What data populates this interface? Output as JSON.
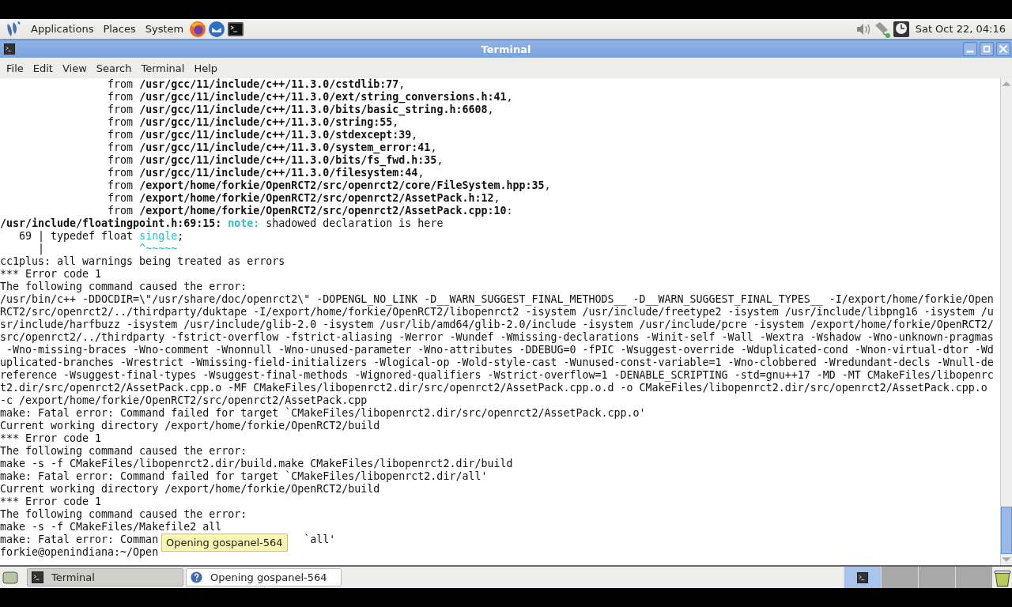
{
  "top_panel": {
    "menus": [
      "Applications",
      "Places",
      "System"
    ],
    "clock": "Sat Oct 22, 04:16"
  },
  "window": {
    "title": "Terminal"
  },
  "menubar": [
    "File",
    "Edit",
    "View",
    "Search",
    "Terminal",
    "Help"
  ],
  "terminal": {
    "lines": [
      [
        {
          "text": "                 from ",
          "kind": "plain"
        },
        {
          "text": "/usr/gcc/11/include/c++/11.3.0/cstdlib:77",
          "kind": "bold"
        },
        {
          "text": ",",
          "kind": "plain"
        }
      ],
      [
        {
          "text": "                 from ",
          "kind": "plain"
        },
        {
          "text": "/usr/gcc/11/include/c++/11.3.0/ext/string_conversions.h:41",
          "kind": "bold"
        },
        {
          "text": ",",
          "kind": "plain"
        }
      ],
      [
        {
          "text": "                 from ",
          "kind": "plain"
        },
        {
          "text": "/usr/gcc/11/include/c++/11.3.0/bits/basic_string.h:6608",
          "kind": "bold"
        },
        {
          "text": ",",
          "kind": "plain"
        }
      ],
      [
        {
          "text": "                 from ",
          "kind": "plain"
        },
        {
          "text": "/usr/gcc/11/include/c++/11.3.0/string:55",
          "kind": "bold"
        },
        {
          "text": ",",
          "kind": "plain"
        }
      ],
      [
        {
          "text": "                 from ",
          "kind": "plain"
        },
        {
          "text": "/usr/gcc/11/include/c++/11.3.0/stdexcept:39",
          "kind": "bold"
        },
        {
          "text": ",",
          "kind": "plain"
        }
      ],
      [
        {
          "text": "                 from ",
          "kind": "plain"
        },
        {
          "text": "/usr/gcc/11/include/c++/11.3.0/system_error:41",
          "kind": "bold"
        },
        {
          "text": ",",
          "kind": "plain"
        }
      ],
      [
        {
          "text": "                 from ",
          "kind": "plain"
        },
        {
          "text": "/usr/gcc/11/include/c++/11.3.0/bits/fs_fwd.h:35",
          "kind": "bold"
        },
        {
          "text": ",",
          "kind": "plain"
        }
      ],
      [
        {
          "text": "                 from ",
          "kind": "plain"
        },
        {
          "text": "/usr/gcc/11/include/c++/11.3.0/filesystem:44",
          "kind": "bold"
        },
        {
          "text": ",",
          "kind": "plain"
        }
      ],
      [
        {
          "text": "                 from ",
          "kind": "plain"
        },
        {
          "text": "/export/home/forkie/OpenRCT2/src/openrct2/core/FileSystem.hpp:35",
          "kind": "bold"
        },
        {
          "text": ",",
          "kind": "plain"
        }
      ],
      [
        {
          "text": "                 from ",
          "kind": "plain"
        },
        {
          "text": "/export/home/forkie/OpenRCT2/src/openrct2/AssetPack.h:12",
          "kind": "bold"
        },
        {
          "text": ",",
          "kind": "plain"
        }
      ],
      [
        {
          "text": "                 from ",
          "kind": "plain"
        },
        {
          "text": "/export/home/forkie/OpenRCT2/src/openrct2/AssetPack.cpp:10",
          "kind": "bold"
        },
        {
          "text": ":",
          "kind": "plain"
        }
      ],
      [
        {
          "text": "/usr/include/floatingpoint.h:69:15: ",
          "kind": "bold"
        },
        {
          "text": "note:",
          "kind": "note"
        },
        {
          "text": " shadowed declaration is here",
          "kind": "plain"
        }
      ],
      [
        {
          "text": "   69 | typedef float ",
          "kind": "plain"
        },
        {
          "text": "single",
          "kind": "cyan"
        },
        {
          "text": ";",
          "kind": "plain"
        }
      ],
      [
        {
          "text": "      |               ",
          "kind": "plain"
        },
        {
          "text": "^~~~~~",
          "kind": "cyan"
        }
      ],
      [
        {
          "text": "cc1plus: all warnings being treated as errors",
          "kind": "plain"
        }
      ],
      [
        {
          "text": "*** Error code 1",
          "kind": "plain"
        }
      ],
      [
        {
          "text": "The following command caused the error:",
          "kind": "plain"
        }
      ],
      [
        {
          "text": "/usr/bin/c++ -DDOCDIR=\\\"/usr/share/doc/openrct2\\\" -DOPENGL_NO_LINK -D__WARN_SUGGEST_FINAL_METHODS__ -D__WARN_SUGGEST_FINAL_TYPES__ -I/export/home/forkie/Open",
          "kind": "plain"
        }
      ],
      [
        {
          "text": "RCT2/src/openrct2/../thirdparty/duktape -I/export/home/forkie/OpenRCT2/libopenrct2 -isystem /usr/include/freetype2 -isystem /usr/include/libpng16 -isystem /u",
          "kind": "plain"
        }
      ],
      [
        {
          "text": "sr/include/harfbuzz -isystem /usr/include/glib-2.0 -isystem /usr/lib/amd64/glib-2.0/include -isystem /usr/include/pcre -isystem /export/home/forkie/OpenRCT2/",
          "kind": "plain"
        }
      ],
      [
        {
          "text": "src/openrct2/../thirdparty -fstrict-overflow -fstrict-aliasing -Werror -Wundef -Wmissing-declarations -Winit-self -Wall -Wextra -Wshadow -Wno-unknown-pragmas",
          "kind": "plain"
        }
      ],
      [
        {
          "text": " -Wno-missing-braces -Wno-comment -Wnonnull -Wno-unused-parameter -Wno-attributes -DDEBUG=0 -fPIC -Wsuggest-override -Wduplicated-cond -Wnon-virtual-dtor -Wd",
          "kind": "plain"
        }
      ],
      [
        {
          "text": "uplicated-branches -Wrestrict -Wmissing-field-initializers -Wlogical-op -Wold-style-cast -Wunused-const-variable=1 -Wno-clobbered -Wredundant-decls -Wnull-de",
          "kind": "plain"
        }
      ],
      [
        {
          "text": "reference -Wsuggest-final-types -Wsuggest-final-methods -Wignored-qualifiers -Wstrict-overflow=1 -DENABLE_SCRIPTING -std=gnu++17 -MD -MT CMakeFiles/libopenrc",
          "kind": "plain"
        }
      ],
      [
        {
          "text": "t2.dir/src/openrct2/AssetPack.cpp.o -MF CMakeFiles/libopenrct2.dir/src/openrct2/AssetPack.cpp.o.d -o CMakeFiles/libopenrct2.dir/src/openrct2/AssetPack.cpp.o",
          "kind": "plain"
        }
      ],
      [
        {
          "text": "-c /export/home/forkie/OpenRCT2/src/openrct2/AssetPack.cpp",
          "kind": "plain"
        }
      ],
      [
        {
          "text": "make: Fatal error: Command failed for target `CMakeFiles/libopenrct2.dir/src/openrct2/AssetPack.cpp.o'",
          "kind": "plain"
        }
      ],
      [
        {
          "text": "Current working directory /export/home/forkie/OpenRCT2/build",
          "kind": "plain"
        }
      ],
      [
        {
          "text": "*** Error code 1",
          "kind": "plain"
        }
      ],
      [
        {
          "text": "The following command caused the error:",
          "kind": "plain"
        }
      ],
      [
        {
          "text": "make -s -f CMakeFiles/libopenrct2.dir/build.make CMakeFiles/libopenrct2.dir/build",
          "kind": "plain"
        }
      ],
      [
        {
          "text": "make: Fatal error: Command failed for target `CMakeFiles/libopenrct2.dir/all'",
          "kind": "plain"
        }
      ],
      [
        {
          "text": "Current working directory /export/home/forkie/OpenRCT2/build",
          "kind": "plain"
        }
      ],
      [
        {
          "text": "*** Error code 1",
          "kind": "plain"
        }
      ],
      [
        {
          "text": "The following command caused the error:",
          "kind": "plain"
        }
      ],
      [
        {
          "text": "make -s -f CMakeFiles/Makefile2 all",
          "kind": "plain"
        }
      ],
      [
        {
          "text": "make: Fatal error: Comman",
          "kind": "plain"
        },
        {
          "text": "`all'",
          "kind": "past_tooltip"
        }
      ],
      [
        {
          "text": "forkie@openindiana:~/Open",
          "kind": "plain"
        }
      ]
    ]
  },
  "tooltip": "Opening gospanel-564",
  "taskbar": {
    "tasks": [
      {
        "label": "Terminal",
        "kind": "terminal",
        "selected": true
      },
      {
        "label": "Opening gospanel-564",
        "kind": "help",
        "selected": false
      }
    ],
    "workspaces": [
      {
        "selected": true
      },
      {
        "selected": false
      },
      {
        "selected": false
      },
      {
        "selected": false
      }
    ]
  }
}
